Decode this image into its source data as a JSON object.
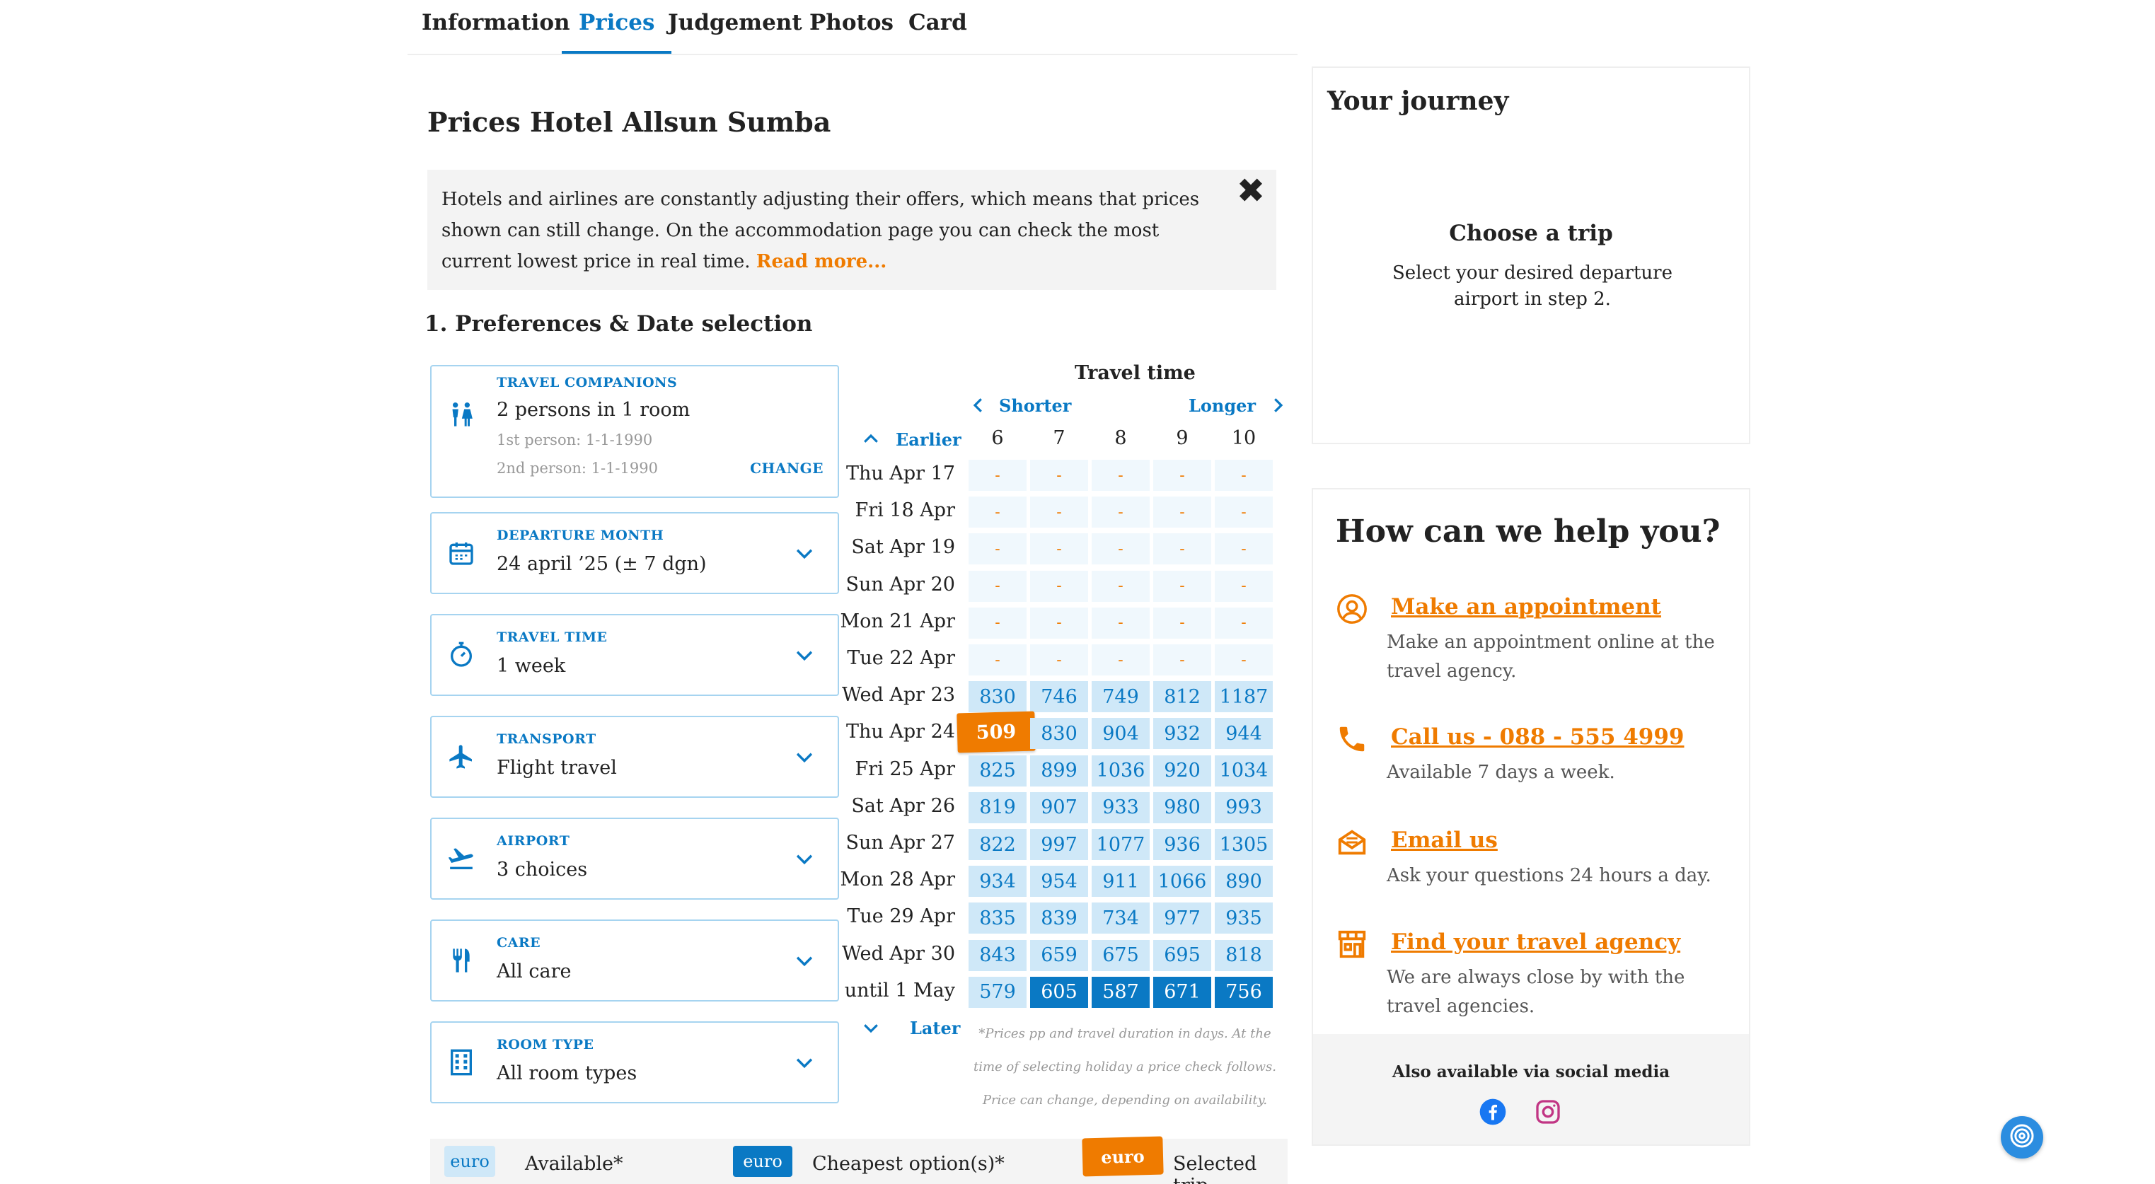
{
  "tabs": [
    "Information",
    "Prices",
    "Judgement",
    "Photos",
    "Card"
  ],
  "page_title": "Prices Hotel Allsun Sumba",
  "notice": {
    "text": "Hotels and airlines are constantly adjusting their offers, which means that prices shown can still change. On the accommodation page you can check the most current lowest price in real time.",
    "read_more": "Read more..."
  },
  "section_title": "1. Preferences & Date selection",
  "preferences": {
    "companions": {
      "label": "TRAVEL COMPANIONS",
      "value": "2 persons in 1 room",
      "person1": "1st person: 1-1-1990",
      "person2": "2nd person: 1-1-1990",
      "change": "CHANGE"
    },
    "departure": {
      "label": "DEPARTURE MONTH",
      "value": "24 april ’25 (± 7 dgn)"
    },
    "travel_time": {
      "label": "TRAVEL TIME",
      "value": "1 week"
    },
    "transport": {
      "label": "TRANSPORT",
      "value": "Flight travel"
    },
    "airport": {
      "label": "AIRPORT",
      "value": "3 choices"
    },
    "care": {
      "label": "CARE",
      "value": "All care"
    },
    "room_type": {
      "label": "ROOM TYPE",
      "value": "All room types"
    }
  },
  "grid": {
    "title": "Travel time",
    "shorter": "Shorter",
    "longer": "Longer",
    "earlier": "Earlier",
    "later": "Later",
    "durations": [
      "6",
      "7",
      "8",
      "9",
      "10"
    ],
    "rows": [
      {
        "date": "Thu Apr 17",
        "cells": [
          [
            "-",
            "none"
          ],
          [
            "-",
            "none"
          ],
          [
            "-",
            "none"
          ],
          [
            "-",
            "none"
          ],
          [
            "-",
            "none"
          ]
        ]
      },
      {
        "date": "Fri 18 Apr",
        "cells": [
          [
            "-",
            "none"
          ],
          [
            "-",
            "none"
          ],
          [
            "-",
            "none"
          ],
          [
            "-",
            "none"
          ],
          [
            "-",
            "none"
          ]
        ]
      },
      {
        "date": "Sat Apr 19",
        "cells": [
          [
            "-",
            "none"
          ],
          [
            "-",
            "none"
          ],
          [
            "-",
            "none"
          ],
          [
            "-",
            "none"
          ],
          [
            "-",
            "none"
          ]
        ]
      },
      {
        "date": "Sun Apr 20",
        "cells": [
          [
            "-",
            "none"
          ],
          [
            "-",
            "none"
          ],
          [
            "-",
            "none"
          ],
          [
            "-",
            "none"
          ],
          [
            "-",
            "none"
          ]
        ]
      },
      {
        "date": "Mon 21 Apr",
        "cells": [
          [
            "-",
            "none"
          ],
          [
            "-",
            "none"
          ],
          [
            "-",
            "none"
          ],
          [
            "-",
            "none"
          ],
          [
            "-",
            "none"
          ]
        ]
      },
      {
        "date": "Tue 22 Apr",
        "cells": [
          [
            "-",
            "none"
          ],
          [
            "-",
            "none"
          ],
          [
            "-",
            "none"
          ],
          [
            "-",
            "none"
          ],
          [
            "-",
            "none"
          ]
        ]
      },
      {
        "date": "Wed Apr 23",
        "cells": [
          [
            "830",
            "avail"
          ],
          [
            "746",
            "avail"
          ],
          [
            "749",
            "avail"
          ],
          [
            "812",
            "avail"
          ],
          [
            "1187",
            "avail"
          ]
        ]
      },
      {
        "date": "Thu Apr 24",
        "cells": [
          [
            "509",
            "selected"
          ],
          [
            "830",
            "avail"
          ],
          [
            "904",
            "avail"
          ],
          [
            "932",
            "avail"
          ],
          [
            "944",
            "avail"
          ]
        ]
      },
      {
        "date": "Fri 25 Apr",
        "cells": [
          [
            "825",
            "avail"
          ],
          [
            "899",
            "avail"
          ],
          [
            "1036",
            "avail"
          ],
          [
            "920",
            "avail"
          ],
          [
            "1034",
            "avail"
          ]
        ]
      },
      {
        "date": "Sat Apr 26",
        "cells": [
          [
            "819",
            "avail"
          ],
          [
            "907",
            "avail"
          ],
          [
            "933",
            "avail"
          ],
          [
            "980",
            "avail"
          ],
          [
            "993",
            "avail"
          ]
        ]
      },
      {
        "date": "Sun Apr 27",
        "cells": [
          [
            "822",
            "avail"
          ],
          [
            "997",
            "avail"
          ],
          [
            "1077",
            "avail"
          ],
          [
            "936",
            "avail"
          ],
          [
            "1305",
            "avail"
          ]
        ]
      },
      {
        "date": "Mon 28 Apr",
        "cells": [
          [
            "934",
            "avail"
          ],
          [
            "954",
            "avail"
          ],
          [
            "911",
            "avail"
          ],
          [
            "1066",
            "avail"
          ],
          [
            "890",
            "avail"
          ]
        ]
      },
      {
        "date": "Tue 29 Apr",
        "cells": [
          [
            "835",
            "avail"
          ],
          [
            "839",
            "avail"
          ],
          [
            "734",
            "avail"
          ],
          [
            "977",
            "avail"
          ],
          [
            "935",
            "avail"
          ]
        ]
      },
      {
        "date": "Wed Apr 30",
        "cells": [
          [
            "843",
            "avail"
          ],
          [
            "659",
            "avail"
          ],
          [
            "675",
            "avail"
          ],
          [
            "695",
            "avail"
          ],
          [
            "818",
            "avail"
          ]
        ]
      },
      {
        "date": "until 1 May",
        "cells": [
          [
            "579",
            "avail"
          ],
          [
            "605",
            "cheap"
          ],
          [
            "587",
            "cheap"
          ],
          [
            "671",
            "cheap"
          ],
          [
            "756",
            "cheap"
          ]
        ]
      }
    ],
    "footnote": "*Prices pp and travel duration in days. At the time of selecting holiday a price check follows. Price can change, depending on availability."
  },
  "legend": {
    "euro": "euro",
    "available": "Available*",
    "cheapest": "Cheapest option(s)*",
    "selected": "Selected trip"
  },
  "journey": {
    "title": "Your journey",
    "subtitle": "Choose a trip",
    "text": "Select your desired departure airport in step 2."
  },
  "help": {
    "title": "How can we help you?",
    "items": [
      {
        "icon": "user-circle-icon",
        "link": "Make an appointment",
        "desc": "Make an appointment online at the travel agency."
      },
      {
        "icon": "phone-icon",
        "link": "Call us - 088 - 555 4999",
        "desc": "Available 7 days a week."
      },
      {
        "icon": "mail-icon",
        "link": "Email us",
        "desc": "Ask your questions 24 hours a day."
      },
      {
        "icon": "store-icon",
        "link": "Find your travel agency",
        "desc": "We are always close by with the travel agencies."
      }
    ],
    "social_title": "Also available via social media"
  },
  "colors": {
    "brand_blue": "#0a79c4",
    "accent_orange": "#ef7b00",
    "available_bg": "#cfe8f8",
    "cheapest_bg": "#0a79c4"
  }
}
